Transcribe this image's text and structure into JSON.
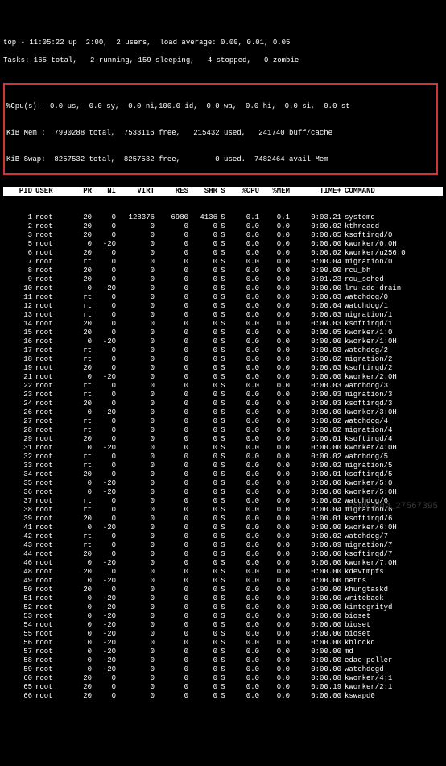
{
  "summary": {
    "line1": "top - 11:05:22 up  2:00,  2 users,  load average: 0.00, 0.01, 0.05",
    "line2": "Tasks: 165 total,   2 running, 159 sleeping,   4 stopped,   0 zombie"
  },
  "boxed": {
    "cpu": "%Cpu(s):  0.0 us,  0.0 sy,  0.0 ni,100.0 id,  0.0 wa,  0.0 hi,  0.0 si,  0.0 st",
    "mem": "KiB Mem :  7990288 total,  7533116 free,   215432 used,   241740 buff/cache",
    "swap": "KiB Swap:  8257532 total,  8257532 free,        0 used.  7482464 avail Mem"
  },
  "headers": {
    "pid": "PID",
    "user": "USER",
    "pr": "PR",
    "ni": "NI",
    "virt": "VIRT",
    "res": "RES",
    "shr": "SHR",
    "s": "S",
    "cpu": "%CPU",
    "mem": "%MEM",
    "time": "TIME+",
    "cmd": "COMMAND"
  },
  "rows": [
    {
      "pid": "1",
      "user": "root",
      "pr": "20",
      "ni": "0",
      "virt": "128376",
      "res": "6980",
      "shr": "4136",
      "s": "S",
      "cpu": "0.1",
      "mem": "0.1",
      "time": "0:03.21",
      "cmd": "systemd"
    },
    {
      "pid": "2",
      "user": "root",
      "pr": "20",
      "ni": "0",
      "virt": "0",
      "res": "0",
      "shr": "0",
      "s": "S",
      "cpu": "0.0",
      "mem": "0.0",
      "time": "0:00.02",
      "cmd": "kthreadd"
    },
    {
      "pid": "3",
      "user": "root",
      "pr": "20",
      "ni": "0",
      "virt": "0",
      "res": "0",
      "shr": "0",
      "s": "S",
      "cpu": "0.0",
      "mem": "0.0",
      "time": "0:00.05",
      "cmd": "ksoftirqd/0"
    },
    {
      "pid": "5",
      "user": "root",
      "pr": "0",
      "ni": "-20",
      "virt": "0",
      "res": "0",
      "shr": "0",
      "s": "S",
      "cpu": "0.0",
      "mem": "0.0",
      "time": "0:00.00",
      "cmd": "kworker/0:0H"
    },
    {
      "pid": "6",
      "user": "root",
      "pr": "20",
      "ni": "0",
      "virt": "0",
      "res": "0",
      "shr": "0",
      "s": "S",
      "cpu": "0.0",
      "mem": "0.0",
      "time": "0:00.02",
      "cmd": "kworker/u256:0"
    },
    {
      "pid": "7",
      "user": "root",
      "pr": "rt",
      "ni": "0",
      "virt": "0",
      "res": "0",
      "shr": "0",
      "s": "S",
      "cpu": "0.0",
      "mem": "0.0",
      "time": "0:00.04",
      "cmd": "migration/0"
    },
    {
      "pid": "8",
      "user": "root",
      "pr": "20",
      "ni": "0",
      "virt": "0",
      "res": "0",
      "shr": "0",
      "s": "S",
      "cpu": "0.0",
      "mem": "0.0",
      "time": "0:00.00",
      "cmd": "rcu_bh"
    },
    {
      "pid": "9",
      "user": "root",
      "pr": "20",
      "ni": "0",
      "virt": "0",
      "res": "0",
      "shr": "0",
      "s": "S",
      "cpu": "0.0",
      "mem": "0.0",
      "time": "0:01.23",
      "cmd": "rcu_sched"
    },
    {
      "pid": "10",
      "user": "root",
      "pr": "0",
      "ni": "-20",
      "virt": "0",
      "res": "0",
      "shr": "0",
      "s": "S",
      "cpu": "0.0",
      "mem": "0.0",
      "time": "0:00.00",
      "cmd": "lru-add-drain"
    },
    {
      "pid": "11",
      "user": "root",
      "pr": "rt",
      "ni": "0",
      "virt": "0",
      "res": "0",
      "shr": "0",
      "s": "S",
      "cpu": "0.0",
      "mem": "0.0",
      "time": "0:00.03",
      "cmd": "watchdog/0"
    },
    {
      "pid": "12",
      "user": "root",
      "pr": "rt",
      "ni": "0",
      "virt": "0",
      "res": "0",
      "shr": "0",
      "s": "S",
      "cpu": "0.0",
      "mem": "0.0",
      "time": "0:00.04",
      "cmd": "watchdog/1"
    },
    {
      "pid": "13",
      "user": "root",
      "pr": "rt",
      "ni": "0",
      "virt": "0",
      "res": "0",
      "shr": "0",
      "s": "S",
      "cpu": "0.0",
      "mem": "0.0",
      "time": "0:00.03",
      "cmd": "migration/1"
    },
    {
      "pid": "14",
      "user": "root",
      "pr": "20",
      "ni": "0",
      "virt": "0",
      "res": "0",
      "shr": "0",
      "s": "S",
      "cpu": "0.0",
      "mem": "0.0",
      "time": "0:00.03",
      "cmd": "ksoftirqd/1"
    },
    {
      "pid": "15",
      "user": "root",
      "pr": "20",
      "ni": "0",
      "virt": "0",
      "res": "0",
      "shr": "0",
      "s": "S",
      "cpu": "0.0",
      "mem": "0.0",
      "time": "0:00.05",
      "cmd": "kworker/1:0"
    },
    {
      "pid": "16",
      "user": "root",
      "pr": "0",
      "ni": "-20",
      "virt": "0",
      "res": "0",
      "shr": "0",
      "s": "S",
      "cpu": "0.0",
      "mem": "0.0",
      "time": "0:00.00",
      "cmd": "kworker/1:0H"
    },
    {
      "pid": "17",
      "user": "root",
      "pr": "rt",
      "ni": "0",
      "virt": "0",
      "res": "0",
      "shr": "0",
      "s": "S",
      "cpu": "0.0",
      "mem": "0.0",
      "time": "0:00.03",
      "cmd": "watchdog/2"
    },
    {
      "pid": "18",
      "user": "root",
      "pr": "rt",
      "ni": "0",
      "virt": "0",
      "res": "0",
      "shr": "0",
      "s": "S",
      "cpu": "0.0",
      "mem": "0.0",
      "time": "0:00.02",
      "cmd": "migration/2"
    },
    {
      "pid": "19",
      "user": "root",
      "pr": "20",
      "ni": "0",
      "virt": "0",
      "res": "0",
      "shr": "0",
      "s": "S",
      "cpu": "0.0",
      "mem": "0.0",
      "time": "0:00.03",
      "cmd": "ksoftirqd/2"
    },
    {
      "pid": "21",
      "user": "root",
      "pr": "0",
      "ni": "-20",
      "virt": "0",
      "res": "0",
      "shr": "0",
      "s": "S",
      "cpu": "0.0",
      "mem": "0.0",
      "time": "0:00.00",
      "cmd": "kworker/2:0H"
    },
    {
      "pid": "22",
      "user": "root",
      "pr": "rt",
      "ni": "0",
      "virt": "0",
      "res": "0",
      "shr": "0",
      "s": "S",
      "cpu": "0.0",
      "mem": "0.0",
      "time": "0:00.03",
      "cmd": "watchdog/3"
    },
    {
      "pid": "23",
      "user": "root",
      "pr": "rt",
      "ni": "0",
      "virt": "0",
      "res": "0",
      "shr": "0",
      "s": "S",
      "cpu": "0.0",
      "mem": "0.0",
      "time": "0:00.03",
      "cmd": "migration/3"
    },
    {
      "pid": "24",
      "user": "root",
      "pr": "20",
      "ni": "0",
      "virt": "0",
      "res": "0",
      "shr": "0",
      "s": "S",
      "cpu": "0.0",
      "mem": "0.0",
      "time": "0:00.03",
      "cmd": "ksoftirqd/3"
    },
    {
      "pid": "26",
      "user": "root",
      "pr": "0",
      "ni": "-20",
      "virt": "0",
      "res": "0",
      "shr": "0",
      "s": "S",
      "cpu": "0.0",
      "mem": "0.0",
      "time": "0:00.00",
      "cmd": "kworker/3:0H"
    },
    {
      "pid": "27",
      "user": "root",
      "pr": "rt",
      "ni": "0",
      "virt": "0",
      "res": "0",
      "shr": "0",
      "s": "S",
      "cpu": "0.0",
      "mem": "0.0",
      "time": "0:00.02",
      "cmd": "watchdog/4"
    },
    {
      "pid": "28",
      "user": "root",
      "pr": "rt",
      "ni": "0",
      "virt": "0",
      "res": "0",
      "shr": "0",
      "s": "S",
      "cpu": "0.0",
      "mem": "0.0",
      "time": "0:00.02",
      "cmd": "migration/4"
    },
    {
      "pid": "29",
      "user": "root",
      "pr": "20",
      "ni": "0",
      "virt": "0",
      "res": "0",
      "shr": "0",
      "s": "S",
      "cpu": "0.0",
      "mem": "0.0",
      "time": "0:00.01",
      "cmd": "ksoftirqd/4"
    },
    {
      "pid": "31",
      "user": "root",
      "pr": "0",
      "ni": "-20",
      "virt": "0",
      "res": "0",
      "shr": "0",
      "s": "S",
      "cpu": "0.0",
      "mem": "0.0",
      "time": "0:00.00",
      "cmd": "kworker/4:0H"
    },
    {
      "pid": "32",
      "user": "root",
      "pr": "rt",
      "ni": "0",
      "virt": "0",
      "res": "0",
      "shr": "0",
      "s": "S",
      "cpu": "0.0",
      "mem": "0.0",
      "time": "0:00.02",
      "cmd": "watchdog/5"
    },
    {
      "pid": "33",
      "user": "root",
      "pr": "rt",
      "ni": "0",
      "virt": "0",
      "res": "0",
      "shr": "0",
      "s": "S",
      "cpu": "0.0",
      "mem": "0.0",
      "time": "0:00.02",
      "cmd": "migration/5"
    },
    {
      "pid": "34",
      "user": "root",
      "pr": "20",
      "ni": "0",
      "virt": "0",
      "res": "0",
      "shr": "0",
      "s": "S",
      "cpu": "0.0",
      "mem": "0.0",
      "time": "0:00.01",
      "cmd": "ksoftirqd/5"
    },
    {
      "pid": "35",
      "user": "root",
      "pr": "0",
      "ni": "-20",
      "virt": "0",
      "res": "0",
      "shr": "0",
      "s": "S",
      "cpu": "0.0",
      "mem": "0.0",
      "time": "0:00.00",
      "cmd": "kworker/5:0"
    },
    {
      "pid": "36",
      "user": "root",
      "pr": "0",
      "ni": "-20",
      "virt": "0",
      "res": "0",
      "shr": "0",
      "s": "S",
      "cpu": "0.0",
      "mem": "0.0",
      "time": "0:00.00",
      "cmd": "kworker/5:0H"
    },
    {
      "pid": "37",
      "user": "root",
      "pr": "rt",
      "ni": "0",
      "virt": "0",
      "res": "0",
      "shr": "0",
      "s": "S",
      "cpu": "0.0",
      "mem": "0.0",
      "time": "0:00.02",
      "cmd": "watchdog/6"
    },
    {
      "pid": "38",
      "user": "root",
      "pr": "rt",
      "ni": "0",
      "virt": "0",
      "res": "0",
      "shr": "0",
      "s": "S",
      "cpu": "0.0",
      "mem": "0.0",
      "time": "0:00.04",
      "cmd": "migration/6"
    },
    {
      "pid": "39",
      "user": "root",
      "pr": "20",
      "ni": "0",
      "virt": "0",
      "res": "0",
      "shr": "0",
      "s": "S",
      "cpu": "0.0",
      "mem": "0.0",
      "time": "0:00.01",
      "cmd": "ksoftirqd/6"
    },
    {
      "pid": "41",
      "user": "root",
      "pr": "0",
      "ni": "-20",
      "virt": "0",
      "res": "0",
      "shr": "0",
      "s": "S",
      "cpu": "0.0",
      "mem": "0.0",
      "time": "0:00.00",
      "cmd": "kworker/6:0H"
    },
    {
      "pid": "42",
      "user": "root",
      "pr": "rt",
      "ni": "0",
      "virt": "0",
      "res": "0",
      "shr": "0",
      "s": "S",
      "cpu": "0.0",
      "mem": "0.0",
      "time": "0:00.02",
      "cmd": "watchdog/7"
    },
    {
      "pid": "43",
      "user": "root",
      "pr": "rt",
      "ni": "0",
      "virt": "0",
      "res": "0",
      "shr": "0",
      "s": "S",
      "cpu": "0.0",
      "mem": "0.0",
      "time": "0:00.09",
      "cmd": "migration/7"
    },
    {
      "pid": "44",
      "user": "root",
      "pr": "20",
      "ni": "0",
      "virt": "0",
      "res": "0",
      "shr": "0",
      "s": "S",
      "cpu": "0.0",
      "mem": "0.0",
      "time": "0:00.00",
      "cmd": "ksoftirqd/7"
    },
    {
      "pid": "46",
      "user": "root",
      "pr": "0",
      "ni": "-20",
      "virt": "0",
      "res": "0",
      "shr": "0",
      "s": "S",
      "cpu": "0.0",
      "mem": "0.0",
      "time": "0:00.00",
      "cmd": "kworker/7:0H"
    },
    {
      "pid": "48",
      "user": "root",
      "pr": "20",
      "ni": "0",
      "virt": "0",
      "res": "0",
      "shr": "0",
      "s": "S",
      "cpu": "0.0",
      "mem": "0.0",
      "time": "0:00.00",
      "cmd": "kdevtmpfs"
    },
    {
      "pid": "49",
      "user": "root",
      "pr": "0",
      "ni": "-20",
      "virt": "0",
      "res": "0",
      "shr": "0",
      "s": "S",
      "cpu": "0.0",
      "mem": "0.0",
      "time": "0:00.00",
      "cmd": "netns"
    },
    {
      "pid": "50",
      "user": "root",
      "pr": "20",
      "ni": "0",
      "virt": "0",
      "res": "0",
      "shr": "0",
      "s": "S",
      "cpu": "0.0",
      "mem": "0.0",
      "time": "0:00.00",
      "cmd": "khungtaskd"
    },
    {
      "pid": "51",
      "user": "root",
      "pr": "0",
      "ni": "-20",
      "virt": "0",
      "res": "0",
      "shr": "0",
      "s": "S",
      "cpu": "0.0",
      "mem": "0.0",
      "time": "0:00.00",
      "cmd": "writeback"
    },
    {
      "pid": "52",
      "user": "root",
      "pr": "0",
      "ni": "-20",
      "virt": "0",
      "res": "0",
      "shr": "0",
      "s": "S",
      "cpu": "0.0",
      "mem": "0.0",
      "time": "0:00.00",
      "cmd": "kintegrityd"
    },
    {
      "pid": "53",
      "user": "root",
      "pr": "0",
      "ni": "-20",
      "virt": "0",
      "res": "0",
      "shr": "0",
      "s": "S",
      "cpu": "0.0",
      "mem": "0.0",
      "time": "0:00.00",
      "cmd": "bioset"
    },
    {
      "pid": "54",
      "user": "root",
      "pr": "0",
      "ni": "-20",
      "virt": "0",
      "res": "0",
      "shr": "0",
      "s": "S",
      "cpu": "0.0",
      "mem": "0.0",
      "time": "0:00.00",
      "cmd": "bioset"
    },
    {
      "pid": "55",
      "user": "root",
      "pr": "0",
      "ni": "-20",
      "virt": "0",
      "res": "0",
      "shr": "0",
      "s": "S",
      "cpu": "0.0",
      "mem": "0.0",
      "time": "0:00.00",
      "cmd": "bioset"
    },
    {
      "pid": "56",
      "user": "root",
      "pr": "0",
      "ni": "-20",
      "virt": "0",
      "res": "0",
      "shr": "0",
      "s": "S",
      "cpu": "0.0",
      "mem": "0.0",
      "time": "0:00.00",
      "cmd": "kblockd"
    },
    {
      "pid": "57",
      "user": "root",
      "pr": "0",
      "ni": "-20",
      "virt": "0",
      "res": "0",
      "shr": "0",
      "s": "S",
      "cpu": "0.0",
      "mem": "0.0",
      "time": "0:00.00",
      "cmd": "md"
    },
    {
      "pid": "58",
      "user": "root",
      "pr": "0",
      "ni": "-20",
      "virt": "0",
      "res": "0",
      "shr": "0",
      "s": "S",
      "cpu": "0.0",
      "mem": "0.0",
      "time": "0:00.00",
      "cmd": "edac-poller"
    },
    {
      "pid": "59",
      "user": "root",
      "pr": "0",
      "ni": "-20",
      "virt": "0",
      "res": "0",
      "shr": "0",
      "s": "S",
      "cpu": "0.0",
      "mem": "0.0",
      "time": "0:00.00",
      "cmd": "watchdogd"
    },
    {
      "pid": "60",
      "user": "root",
      "pr": "20",
      "ni": "0",
      "virt": "0",
      "res": "0",
      "shr": "0",
      "s": "S",
      "cpu": "0.0",
      "mem": "0.0",
      "time": "0:00.08",
      "cmd": "kworker/4:1"
    },
    {
      "pid": "65",
      "user": "root",
      "pr": "20",
      "ni": "0",
      "virt": "0",
      "res": "0",
      "shr": "0",
      "s": "S",
      "cpu": "0.0",
      "mem": "0.0",
      "time": "0:00.19",
      "cmd": "kworker/2:1"
    },
    {
      "pid": "66",
      "user": "root",
      "pr": "20",
      "ni": "0",
      "virt": "0",
      "res": "0",
      "shr": "0",
      "s": "S",
      "cpu": "0.0",
      "mem": "0.0",
      "time": "0:00.00",
      "cmd": "kswapd0"
    }
  ],
  "watermark": "CSDN @qq_27567395"
}
